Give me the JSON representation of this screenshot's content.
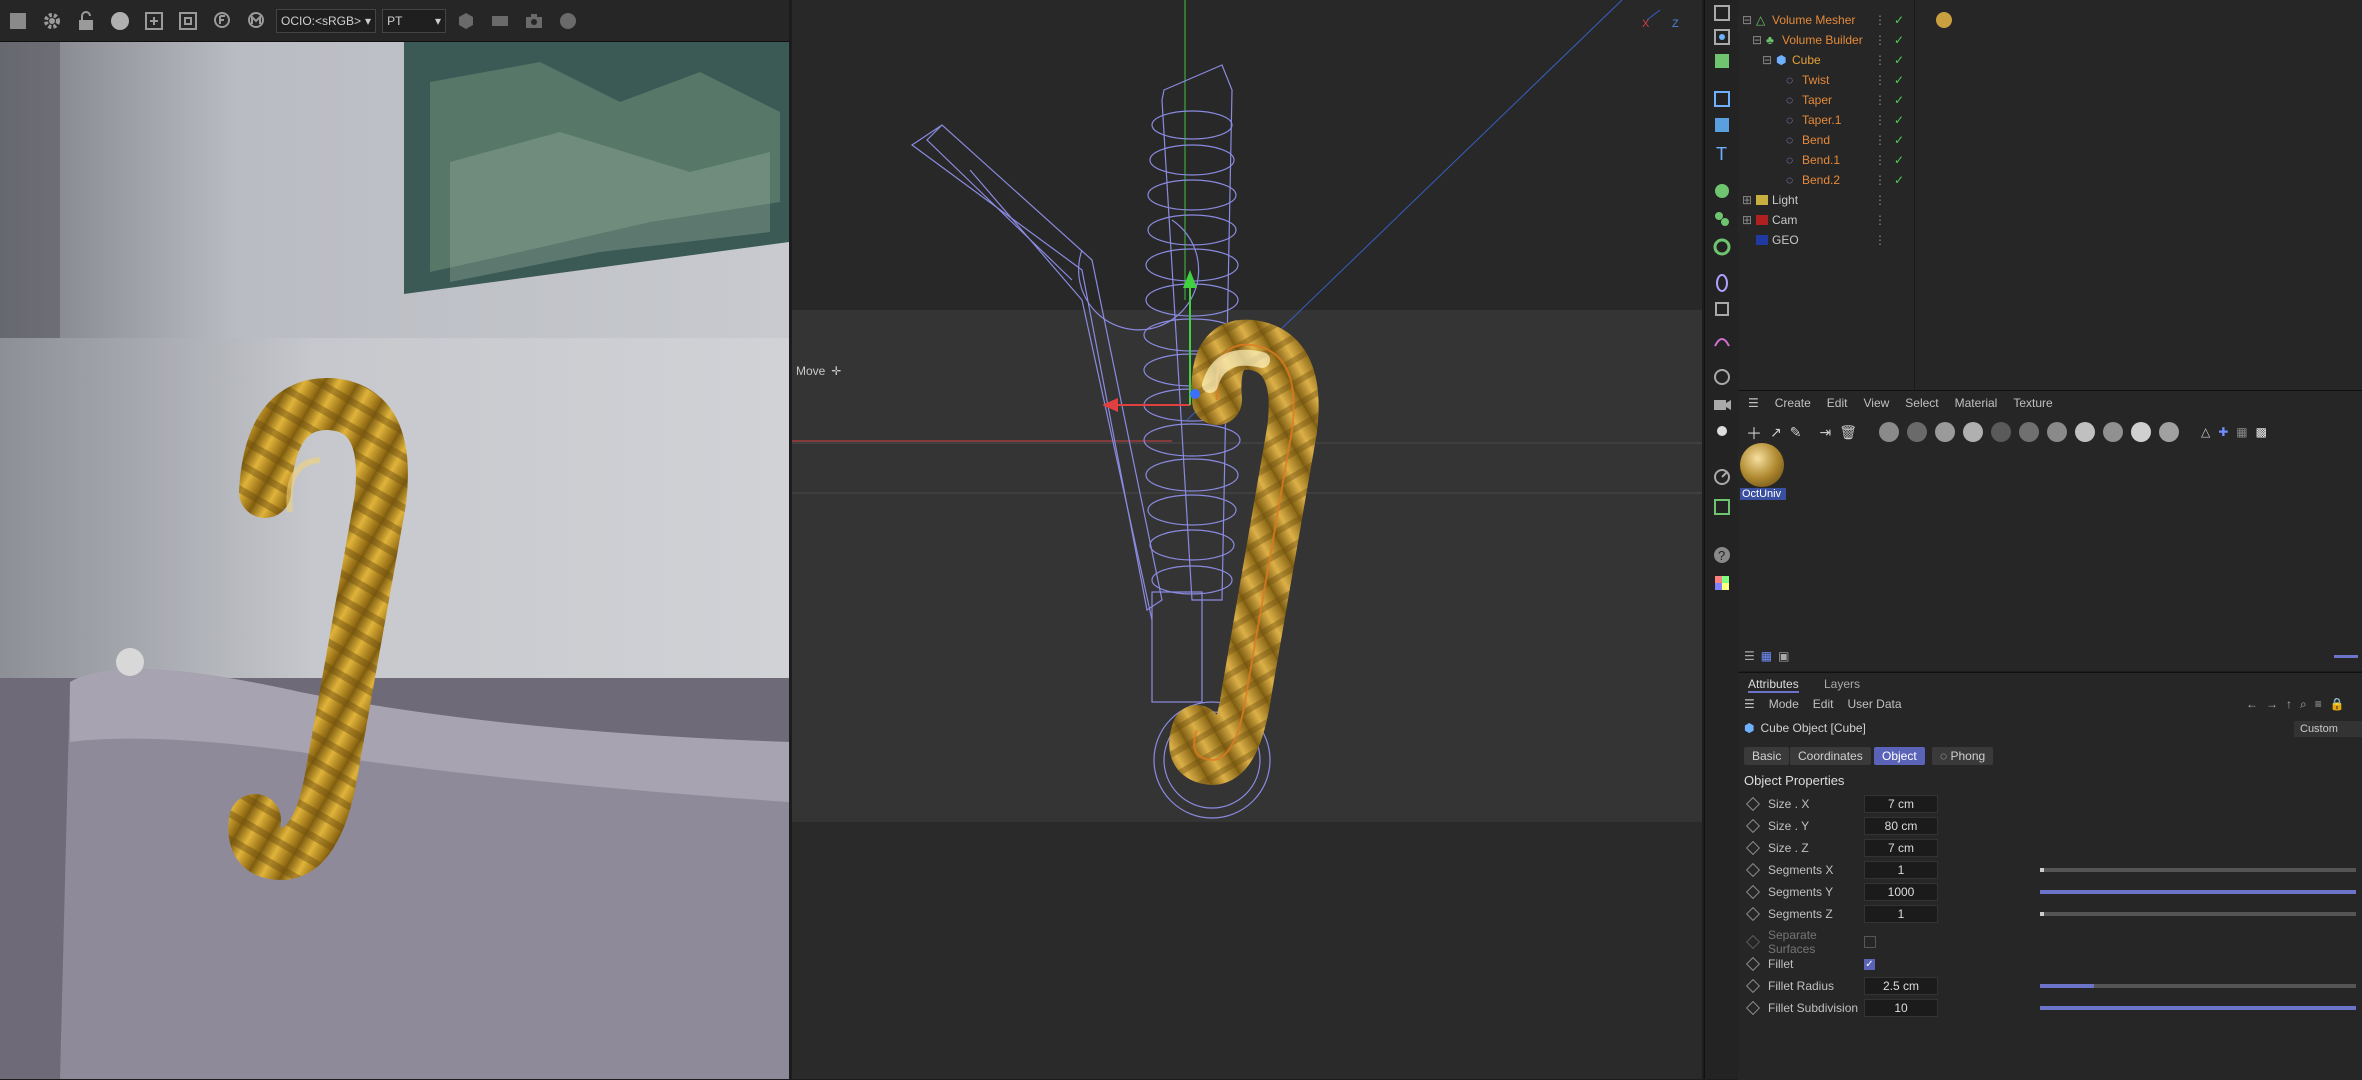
{
  "viewer": {
    "toolbar": {
      "ocio": "OCIO:<sRGB>",
      "pt": "PT"
    }
  },
  "viewport": {
    "move_label": "Move"
  },
  "object_manager": {
    "rows": [
      {
        "name": "Volume Mesher",
        "color": "#e58a3a"
      },
      {
        "name": "Volume Builder",
        "color": "#e58a3a"
      },
      {
        "name": "Cube",
        "color": "#e5a03a"
      },
      {
        "name": "Twist",
        "color": "#e58a3a"
      },
      {
        "name": "Taper",
        "color": "#e58a3a"
      },
      {
        "name": "Taper.1",
        "color": "#e58a3a"
      },
      {
        "name": "Bend",
        "color": "#e58a3a"
      },
      {
        "name": "Bend.1",
        "color": "#e58a3a"
      },
      {
        "name": "Bend.2",
        "color": "#e58a3a"
      },
      {
        "name": "Light",
        "color": "#c8c8c8"
      },
      {
        "name": "Cam",
        "color": "#c8c8c8"
      },
      {
        "name": "GEO",
        "color": "#c8c8c8"
      }
    ]
  },
  "material_manager": {
    "menu": [
      "Create",
      "Edit",
      "View",
      "Select",
      "Material",
      "Texture"
    ],
    "material_name": "OctUniv"
  },
  "attributes": {
    "tabs": [
      "Attributes",
      "Layers"
    ],
    "menu": [
      "Mode",
      "Edit",
      "User Data"
    ],
    "object_title": "Cube Object [Cube]",
    "preset": "Custom",
    "sub_tabs": [
      "Basic",
      "Coordinates",
      "Object",
      "Phong"
    ],
    "section": "Object Properties",
    "fields": [
      {
        "label": "Size . X",
        "value": "7 cm"
      },
      {
        "label": "Size . Y",
        "value": "80 cm"
      },
      {
        "label": "Size . Z",
        "value": "7 cm"
      },
      {
        "label": "Segments X",
        "value": "1"
      },
      {
        "label": "Segments Y",
        "value": "1000"
      },
      {
        "label": "Segments Z",
        "value": "1"
      }
    ],
    "separate_surfaces": "Separate Surfaces",
    "fillet": "Fillet",
    "fillet_radius": {
      "label": "Fillet Radius",
      "value": "2.5 cm"
    },
    "fillet_subdivision": {
      "label": "Fillet Subdivision",
      "value": "10"
    }
  }
}
